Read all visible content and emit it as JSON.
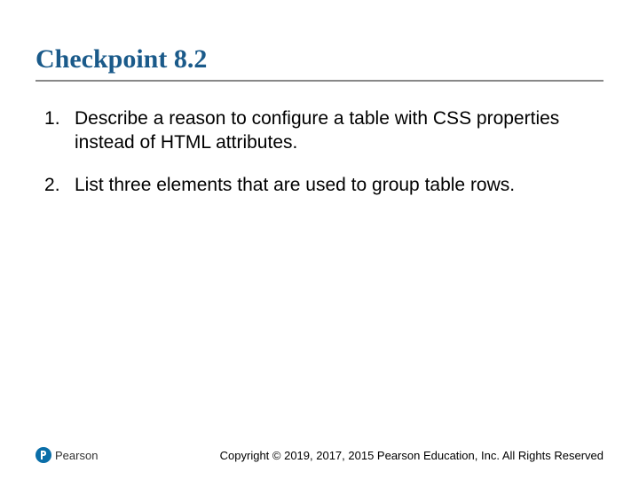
{
  "title": "Checkpoint 8.2",
  "items": [
    "Describe a reason to configure a table with CSS properties instead of HTML attributes.",
    "List three elements that are used to group table rows."
  ],
  "publisher": "Pearson",
  "copyright": "Copyright © 2019, 2017, 2015 Pearson Education, Inc. All Rights Reserved"
}
